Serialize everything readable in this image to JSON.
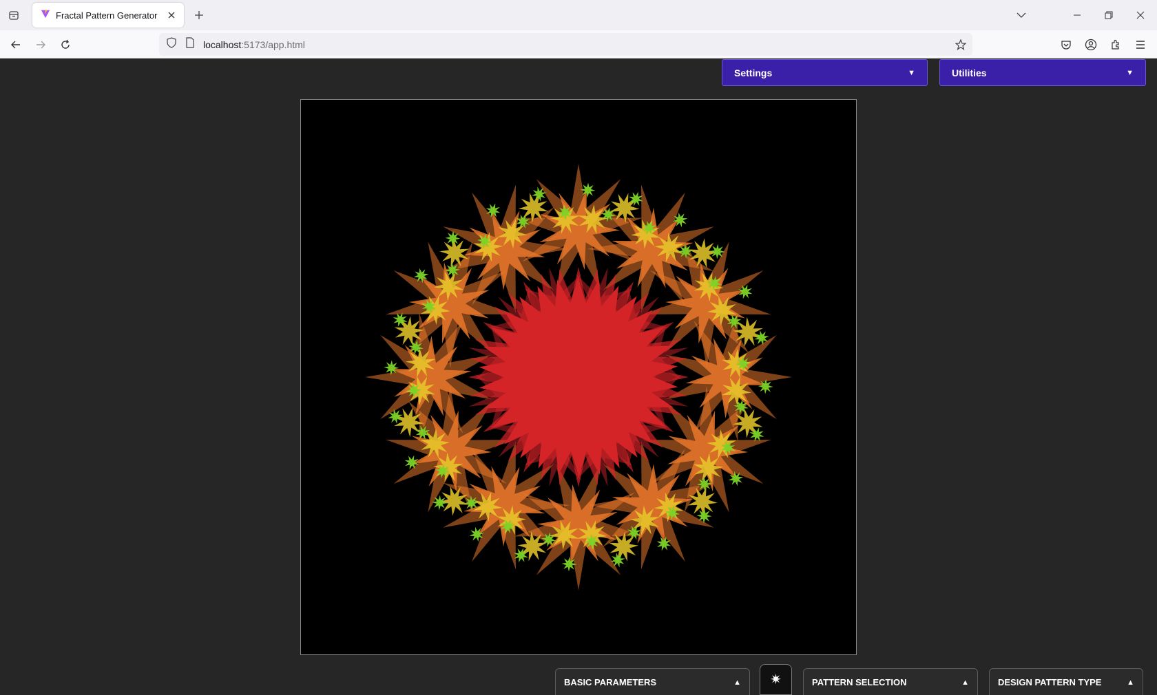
{
  "browser": {
    "tab_title": "Fractal Pattern Generator",
    "url_host": "localhost",
    "url_path": ":5173/app.html"
  },
  "app": {
    "settings_label": "Settings",
    "utilities_label": "Utilities",
    "caret_down": "▼",
    "caret_up": "▲",
    "generate_symbol": "✷",
    "panels": {
      "basic_parameters": "BASIC PARAMETERS",
      "pattern_selection": "PATTERN SELECTION",
      "design_pattern_type": "DESIGN PATTERN TYPE"
    }
  },
  "colors": {
    "dropdown_bg": "#3a1fa8",
    "page_bg": "#262626",
    "canvas_bg": "#000000",
    "core": "#d42428",
    "ring_large": "#e8772a",
    "ring_medium": "#e9c92a",
    "ring_small": "#7cd326"
  }
}
